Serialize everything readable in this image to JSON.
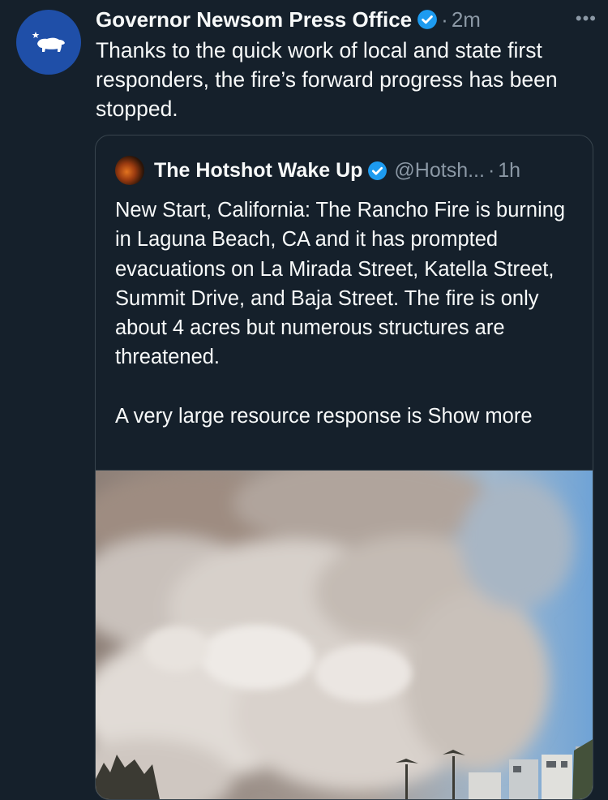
{
  "tweet": {
    "author_name": "Governor Newsom Press Office",
    "separator": "·",
    "time": "2m",
    "more_label": "•••",
    "text": "Thanks to the quick work of local and state first responders, the fire’s forward progress has been stopped."
  },
  "quoted_tweet": {
    "author_name": "The Hotshot Wake Up",
    "handle": "@Hotsh...",
    "separator": "·",
    "time": "1h",
    "text": "New Start, California: The Rancho Fire is burning in Laguna Beach, CA and it has prompted evacuations on La Mirada Street, Katella Street, Summit Drive, and Baja Street. The fire is only about 4 acres but numerous structures are threatened.",
    "text2": "A very large resource response is",
    "show_more": "Show more"
  },
  "colors": {
    "background": "#15202b",
    "verified": "#1d9bf0",
    "secondary_text": "#8b98a5",
    "avatar_bg": "#1f4fa8"
  },
  "icons": [
    "california-bear-icon",
    "verified-badge-icon",
    "more-options-icon"
  ]
}
